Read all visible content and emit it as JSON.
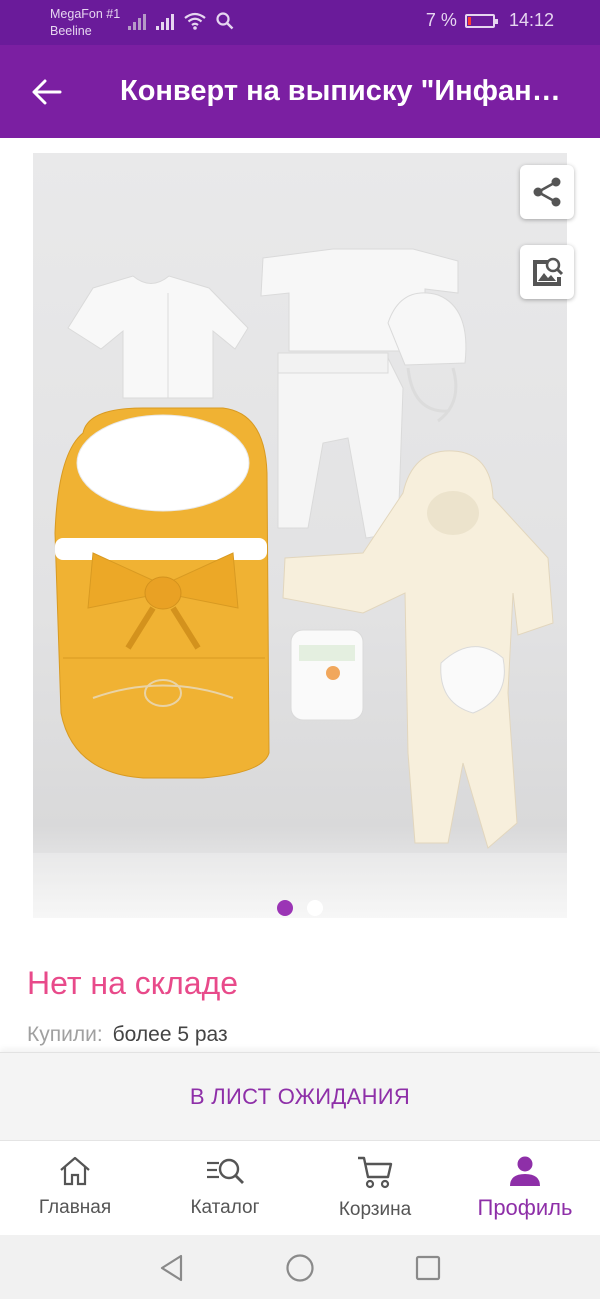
{
  "status_bar": {
    "carrier1": "MegaFon #1",
    "carrier2": "Beeline",
    "battery": "7 %",
    "time": "14:12",
    "battery_level": 0.07
  },
  "toolbar": {
    "back_icon": "arrow-left-icon",
    "title": "Конверт на выписку \"Инфанта\""
  },
  "gallery": {
    "share_icon": "share-icon",
    "image_search_icon": "image-search-icon",
    "page_count": 2,
    "active_page": 1
  },
  "product": {
    "stock_status": "Нет на складе",
    "bought_label": "Купили:",
    "bought_value": "более 5 раз"
  },
  "waitlist_button": "В ЛИСТ ОЖИДАНИЯ",
  "bottom_nav": [
    {
      "label": "Главная",
      "icon": "home-icon"
    },
    {
      "label": "Каталог",
      "icon": "catalog-search-icon"
    },
    {
      "label": "Корзина",
      "icon": "cart-icon"
    },
    {
      "label": "Профиль",
      "icon": "profile-icon",
      "active": true
    }
  ],
  "colors": {
    "status_bar": "#6a1b9a",
    "toolbar": "#7b1fa2",
    "accent": "#8e2fa8",
    "stock_status": "#e84a8a"
  }
}
